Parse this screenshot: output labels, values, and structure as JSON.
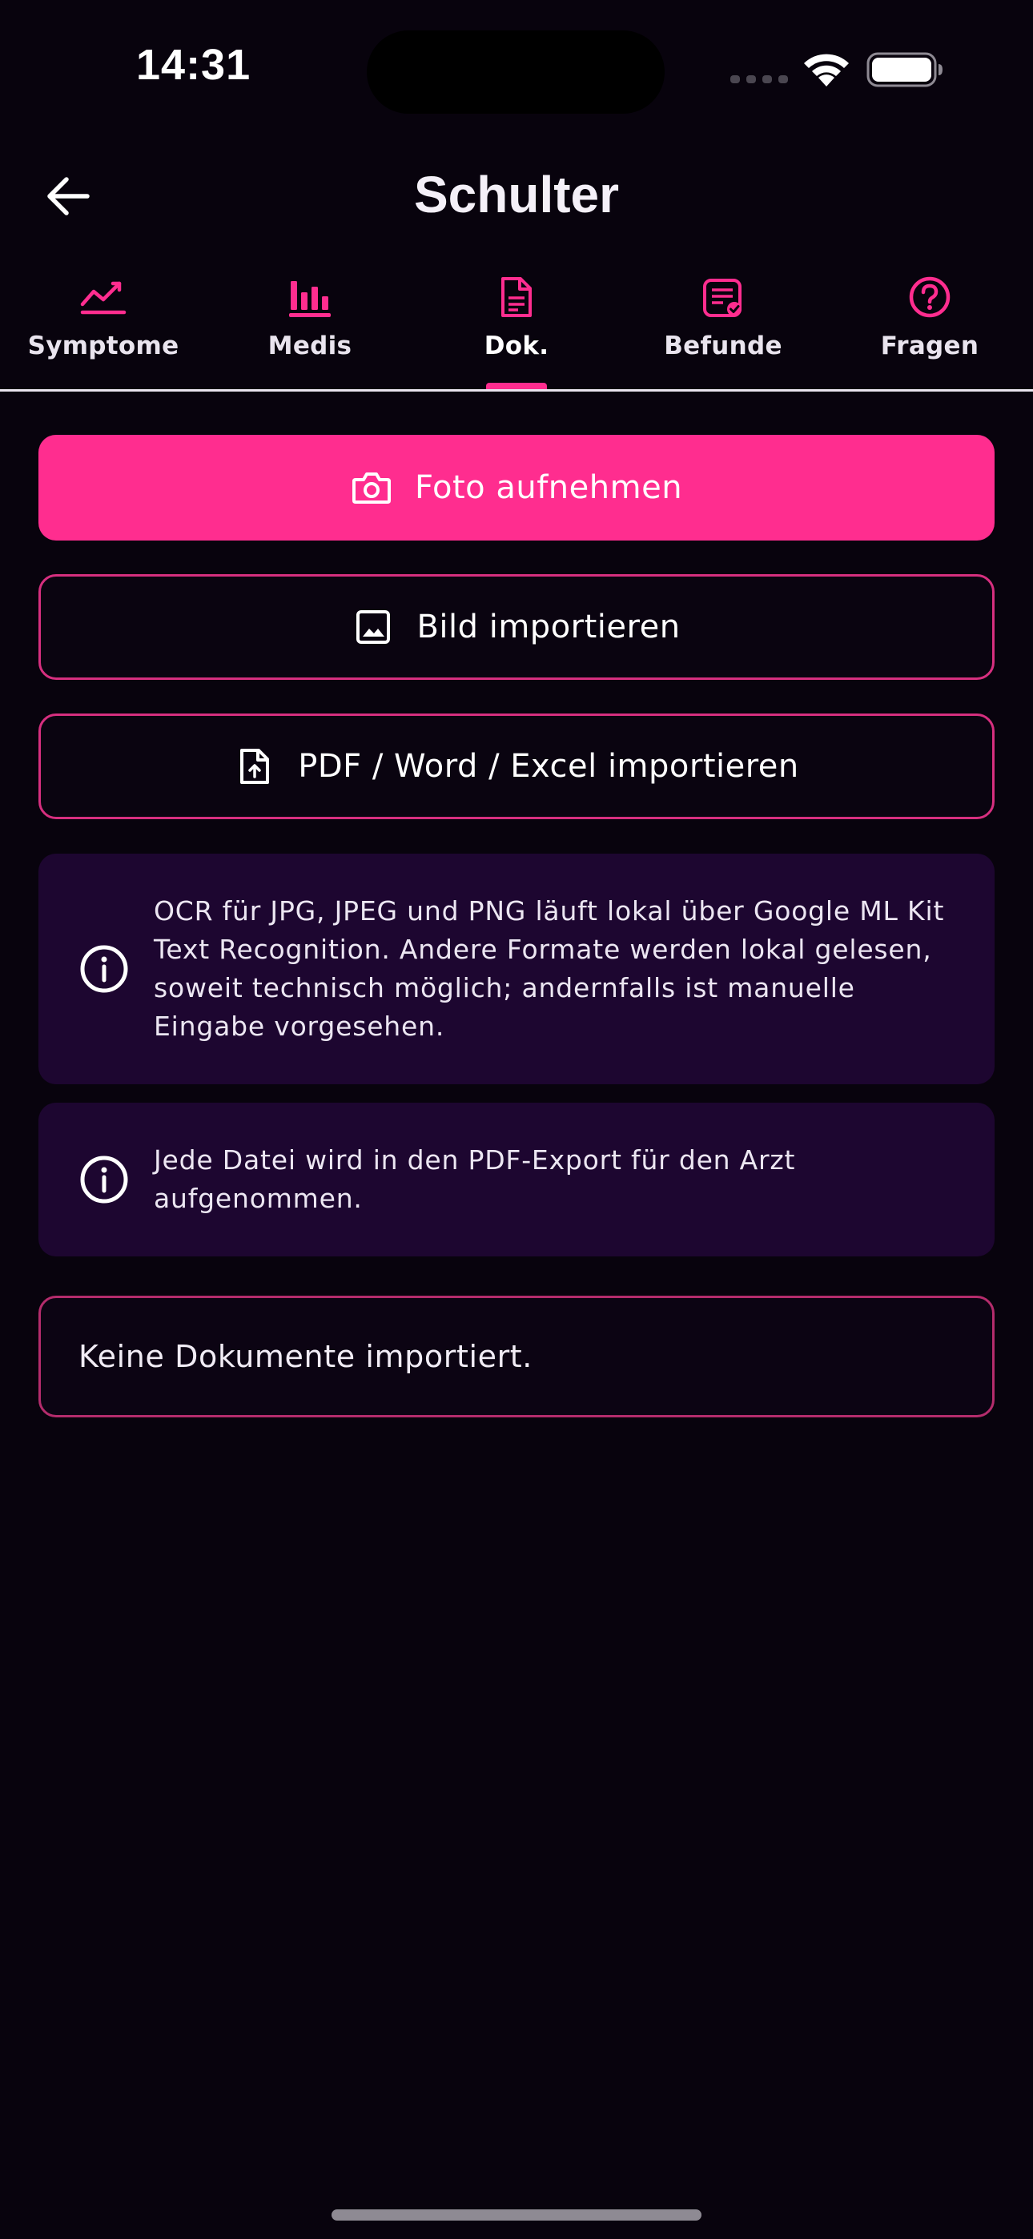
{
  "status_bar": {
    "time": "14:31"
  },
  "app_bar": {
    "title": "Schulter",
    "back_icon": "arrow-left-icon"
  },
  "tabs": [
    {
      "label": "Symptome",
      "icon": "trend-line-icon",
      "active": false
    },
    {
      "label": "Medis",
      "icon": "bar-chart-icon",
      "active": false
    },
    {
      "label": "Dok.",
      "icon": "document-icon",
      "active": true
    },
    {
      "label": "Befunde",
      "icon": "clipboard-check-icon",
      "active": false
    },
    {
      "label": "Fragen",
      "icon": "help-circle-icon",
      "active": false
    }
  ],
  "actions": {
    "take_photo": {
      "label": "Foto aufnehmen",
      "icon": "camera-icon"
    },
    "import_image": {
      "label": "Bild importieren",
      "icon": "image-icon"
    },
    "import_file": {
      "label": "PDF / Word / Excel importieren",
      "icon": "file-upload-icon"
    }
  },
  "info": {
    "ocr_note": "OCR für JPG, JPEG und PNG läuft lokal über Google ML Kit Text Recognition. Andere Formate werden lokal gelesen, soweit technisch möglich; andernfalls ist manuelle Eingabe vorgesehen.",
    "export_note": "Jede Datei wird in den PDF-Export für den Arzt aufgenommen."
  },
  "documents": {
    "empty_text": "Keine Dokumente importiert.",
    "items": []
  },
  "colors": {
    "background": "#08030d",
    "accent": "#ff2d8f",
    "info_card": "#1d0630",
    "outline": "#d62f7f"
  }
}
